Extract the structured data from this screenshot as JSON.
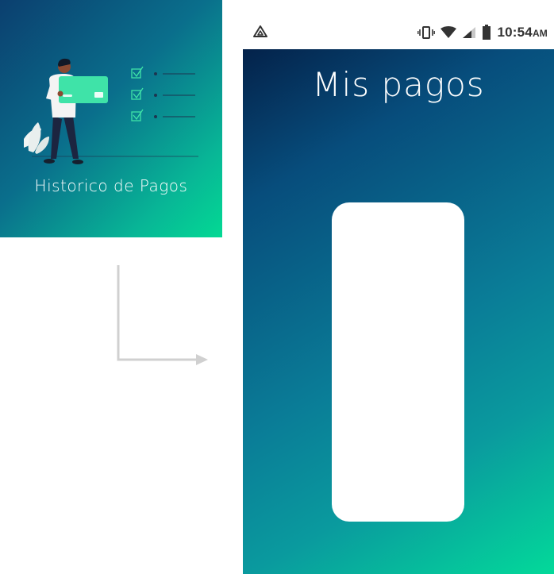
{
  "menu_card": {
    "label": "Historico de Pagos",
    "illustration_icon": "person-holding-credit-card-icon"
  },
  "status_bar": {
    "left_icon": "drive-icon",
    "icons": [
      "vibrate-icon",
      "wifi-icon",
      "cell-signal-icon",
      "battery-icon"
    ],
    "time": "10:54",
    "ampm": "AM"
  },
  "screen": {
    "title": "Mis pagos"
  },
  "colors": {
    "gradient_dark": "#04224a",
    "gradient_mid": "#0a7c97",
    "gradient_light": "#03d99a",
    "arrow": "#d0d0d0"
  }
}
